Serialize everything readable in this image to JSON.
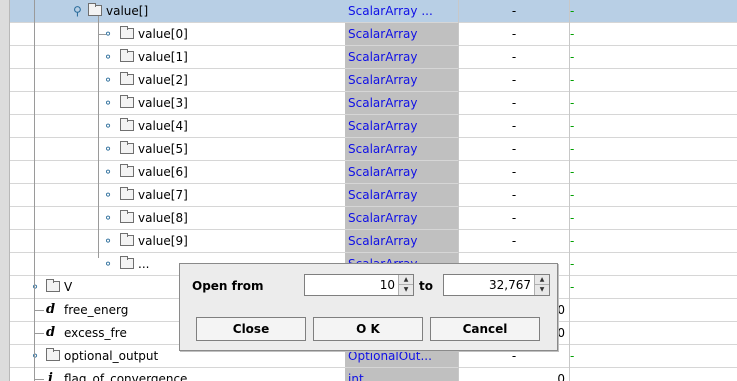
{
  "rows": [
    {
      "name": "value[]",
      "type": "ScalarArray ...",
      "val": "-",
      "selected": true
    },
    {
      "name": "value[0]",
      "type": "ScalarArray",
      "val": "-"
    },
    {
      "name": "value[1]",
      "type": "ScalarArray",
      "val": "-"
    },
    {
      "name": "value[2]",
      "type": "ScalarArray",
      "val": "-"
    },
    {
      "name": "value[3]",
      "type": "ScalarArray",
      "val": "-"
    },
    {
      "name": "value[4]",
      "type": "ScalarArray",
      "val": "-"
    },
    {
      "name": "value[5]",
      "type": "ScalarArray",
      "val": "-"
    },
    {
      "name": "value[6]",
      "type": "ScalarArray",
      "val": "-"
    },
    {
      "name": "value[7]",
      "type": "ScalarArray",
      "val": "-"
    },
    {
      "name": "value[8]",
      "type": "ScalarArray",
      "val": "-"
    },
    {
      "name": "value[9]",
      "type": "ScalarArray",
      "val": "-"
    },
    {
      "name": "...",
      "type": "ScalarArray",
      "val": "-"
    },
    {
      "name": "V",
      "type": "",
      "val": "-"
    },
    {
      "name": "free_energ",
      "type": "",
      "val": "0"
    },
    {
      "name": "excess_fre",
      "type": "",
      "val": "0"
    },
    {
      "name": "optional_output",
      "type": "OptionalOut...",
      "val": "-"
    },
    {
      "name": "flag_of_convergence",
      "type": "int",
      "val": "0"
    }
  ],
  "last_col_marker": "-",
  "dialog": {
    "open_from_label": "Open from",
    "from_value": "10",
    "to_label": "to",
    "to_value": "32,767",
    "close_label": "Close",
    "ok_label": "O K",
    "cancel_label": "Cancel"
  },
  "icons": {
    "expand_handle": "circle-handle-icon",
    "folder": "folder-icon",
    "double": "d-type-icon",
    "int": "i-type-icon"
  }
}
